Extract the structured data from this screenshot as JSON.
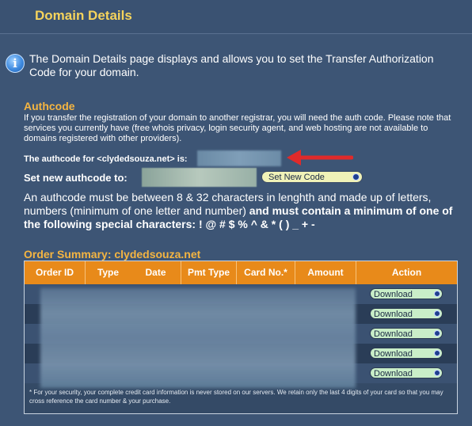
{
  "page": {
    "title": "Domain Details",
    "intro": "The Domain Details page displays and allows you to set the Transfer Authorization Code for your domain."
  },
  "authcode": {
    "heading": "Authcode",
    "description": "If you transfer the registration of your domain to another registrar, you will need the auth code. Please note that services you currently have (free whois privacy, login security agent, and web hosting are not available to domains registered with other providers).",
    "current_label": "The authcode for <clydedsouza.net> is:",
    "set_label": "Set new authcode to:",
    "set_button": "Set New Code",
    "rules_plain": "An authcode must be between 8 & 32 characters in lenghth and made up of letters, numbers (minimum of one letter and number) ",
    "rules_bold": "and must contain a minimum of one of the following special characters:    ! @ # $ % ^ & * ( ) _ + -"
  },
  "orders": {
    "heading": "Order Summary: clydedsouza.net",
    "columns": [
      "Order ID",
      "Type",
      "Date",
      "Pmt Type",
      "Card No.*",
      "Amount",
      "Action"
    ],
    "download_label": "Download",
    "footnote": "* For your security, your complete credit card information is never stored on our servers. We retain only the last 4 digits of your card so that you may cross reference the card number & your purchase."
  },
  "colors": {
    "background": "#3d5575",
    "title": "#f5d35c",
    "heading": "#f5b541",
    "table_header": "#e88a1a",
    "arrow": "#e02a2a"
  }
}
